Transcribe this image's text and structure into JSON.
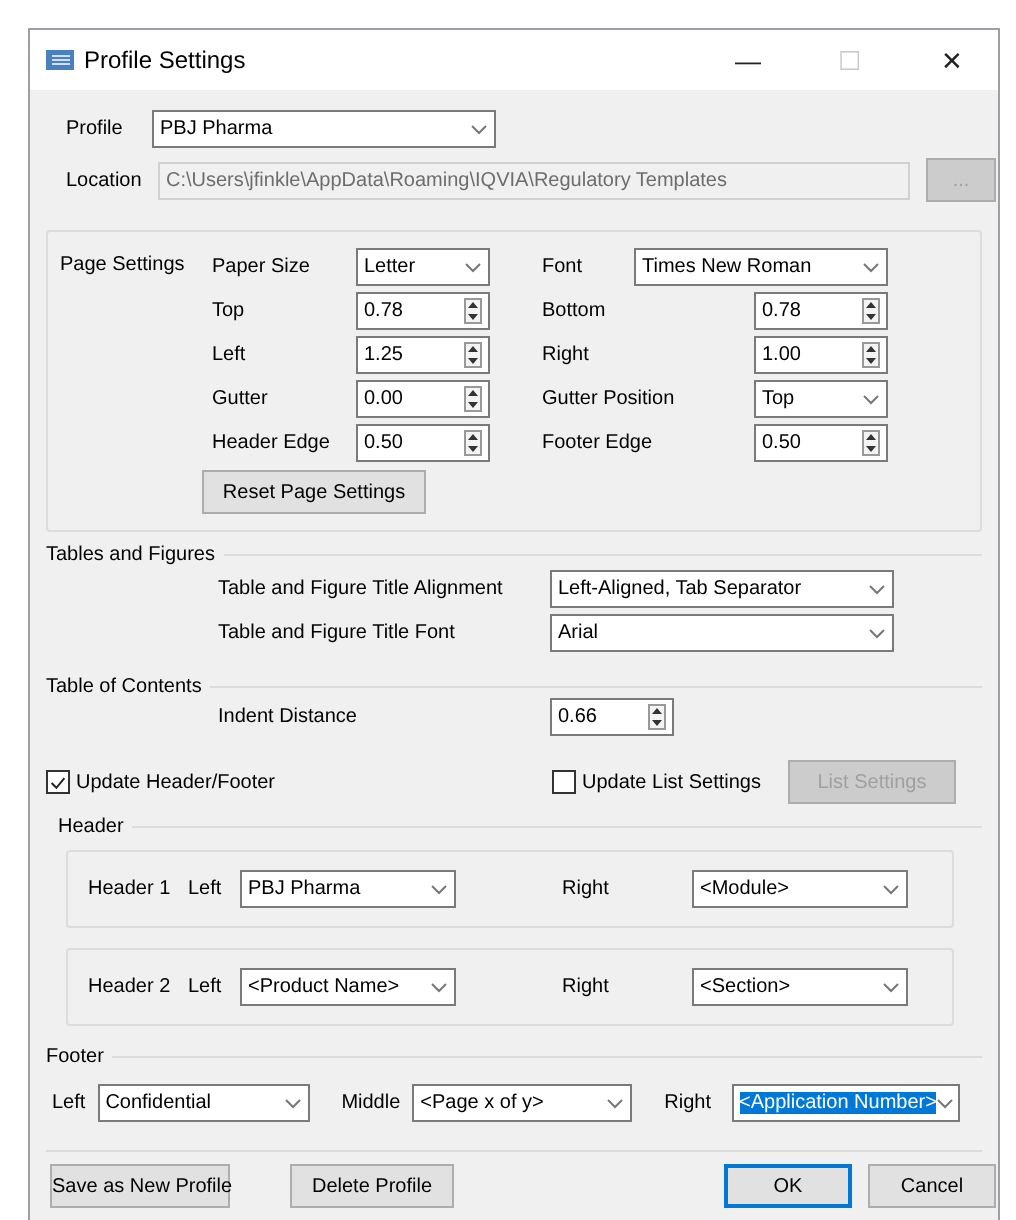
{
  "window": {
    "title": "Profile Settings",
    "controls": [
      "—",
      "☐",
      "✕"
    ]
  },
  "profile": {
    "label": "Profile",
    "value": "PBJ Pharma"
  },
  "location": {
    "label": "Location",
    "value": "C:\\Users\\jfinkle\\AppData\\Roaming\\IQVIA\\Regulatory Templates",
    "disabled": true,
    "browse": "..."
  },
  "page_settings": {
    "title": "Page Settings",
    "fields": [
      {
        "label": "Paper Size",
        "kind": "combo",
        "value": "Letter"
      },
      {
        "label": "Font",
        "kind": "combo",
        "value": "Times New Roman"
      },
      {
        "label": "Top",
        "kind": "spin",
        "value": "0.78"
      },
      {
        "label": "Bottom",
        "kind": "spin",
        "value": "0.78"
      },
      {
        "label": "Left",
        "kind": "spin",
        "value": "1.25"
      },
      {
        "label": "Right",
        "kind": "spin",
        "value": "1.00"
      },
      {
        "label": "Gutter",
        "kind": "spin",
        "value": "0.00"
      },
      {
        "label": "Gutter Position",
        "kind": "combo",
        "value": "Top"
      },
      {
        "label": "Header Edge",
        "kind": "spin",
        "value": "0.50"
      },
      {
        "label": "Footer Edge",
        "kind": "spin",
        "value": "0.50"
      }
    ],
    "reset": "Reset Page Settings"
  },
  "tables_figures": {
    "title": "Tables and Figures",
    "fields": [
      {
        "label": "Table and Figure Title Alignment",
        "kind": "combo",
        "value": "Left-Aligned, Tab Separator"
      },
      {
        "label": "Table and Figure Title Font",
        "kind": "combo",
        "value": "Arial"
      }
    ]
  },
  "toc": {
    "title": "Table of Contents",
    "fields": [
      {
        "label": "Indent Distance",
        "kind": "spin",
        "value": "0.66"
      }
    ]
  },
  "options": [
    {
      "label": "Update Header/Footer",
      "checked": true
    },
    {
      "label": "Update List Settings",
      "checked": false
    }
  ],
  "list_settings": {
    "label": "List Settings",
    "disabled": true
  },
  "header": {
    "title": "Header",
    "rows": [
      {
        "label": "Header 1",
        "left_label": "Left",
        "left": "PBJ Pharma",
        "right_label": "Right",
        "right": "<Module>"
      },
      {
        "label": "Header 2",
        "left_label": "Left",
        "left": "<Product Name>",
        "right_label": "Right",
        "right": "<Section>"
      }
    ]
  },
  "footer": {
    "title": "Footer",
    "fields": [
      {
        "label": "Left",
        "value": "Confidential",
        "selected": false
      },
      {
        "label": "Middle",
        "value": "<Page x of y>",
        "selected": false
      },
      {
        "label": "Right",
        "value": "<Application Number>",
        "selected": true
      }
    ]
  },
  "buttons": [
    {
      "label": "Save as New Profile",
      "default": false
    },
    {
      "label": "Delete Profile",
      "default": false
    },
    {
      "label": "OK",
      "default": true
    },
    {
      "label": "Cancel",
      "default": false
    }
  ]
}
